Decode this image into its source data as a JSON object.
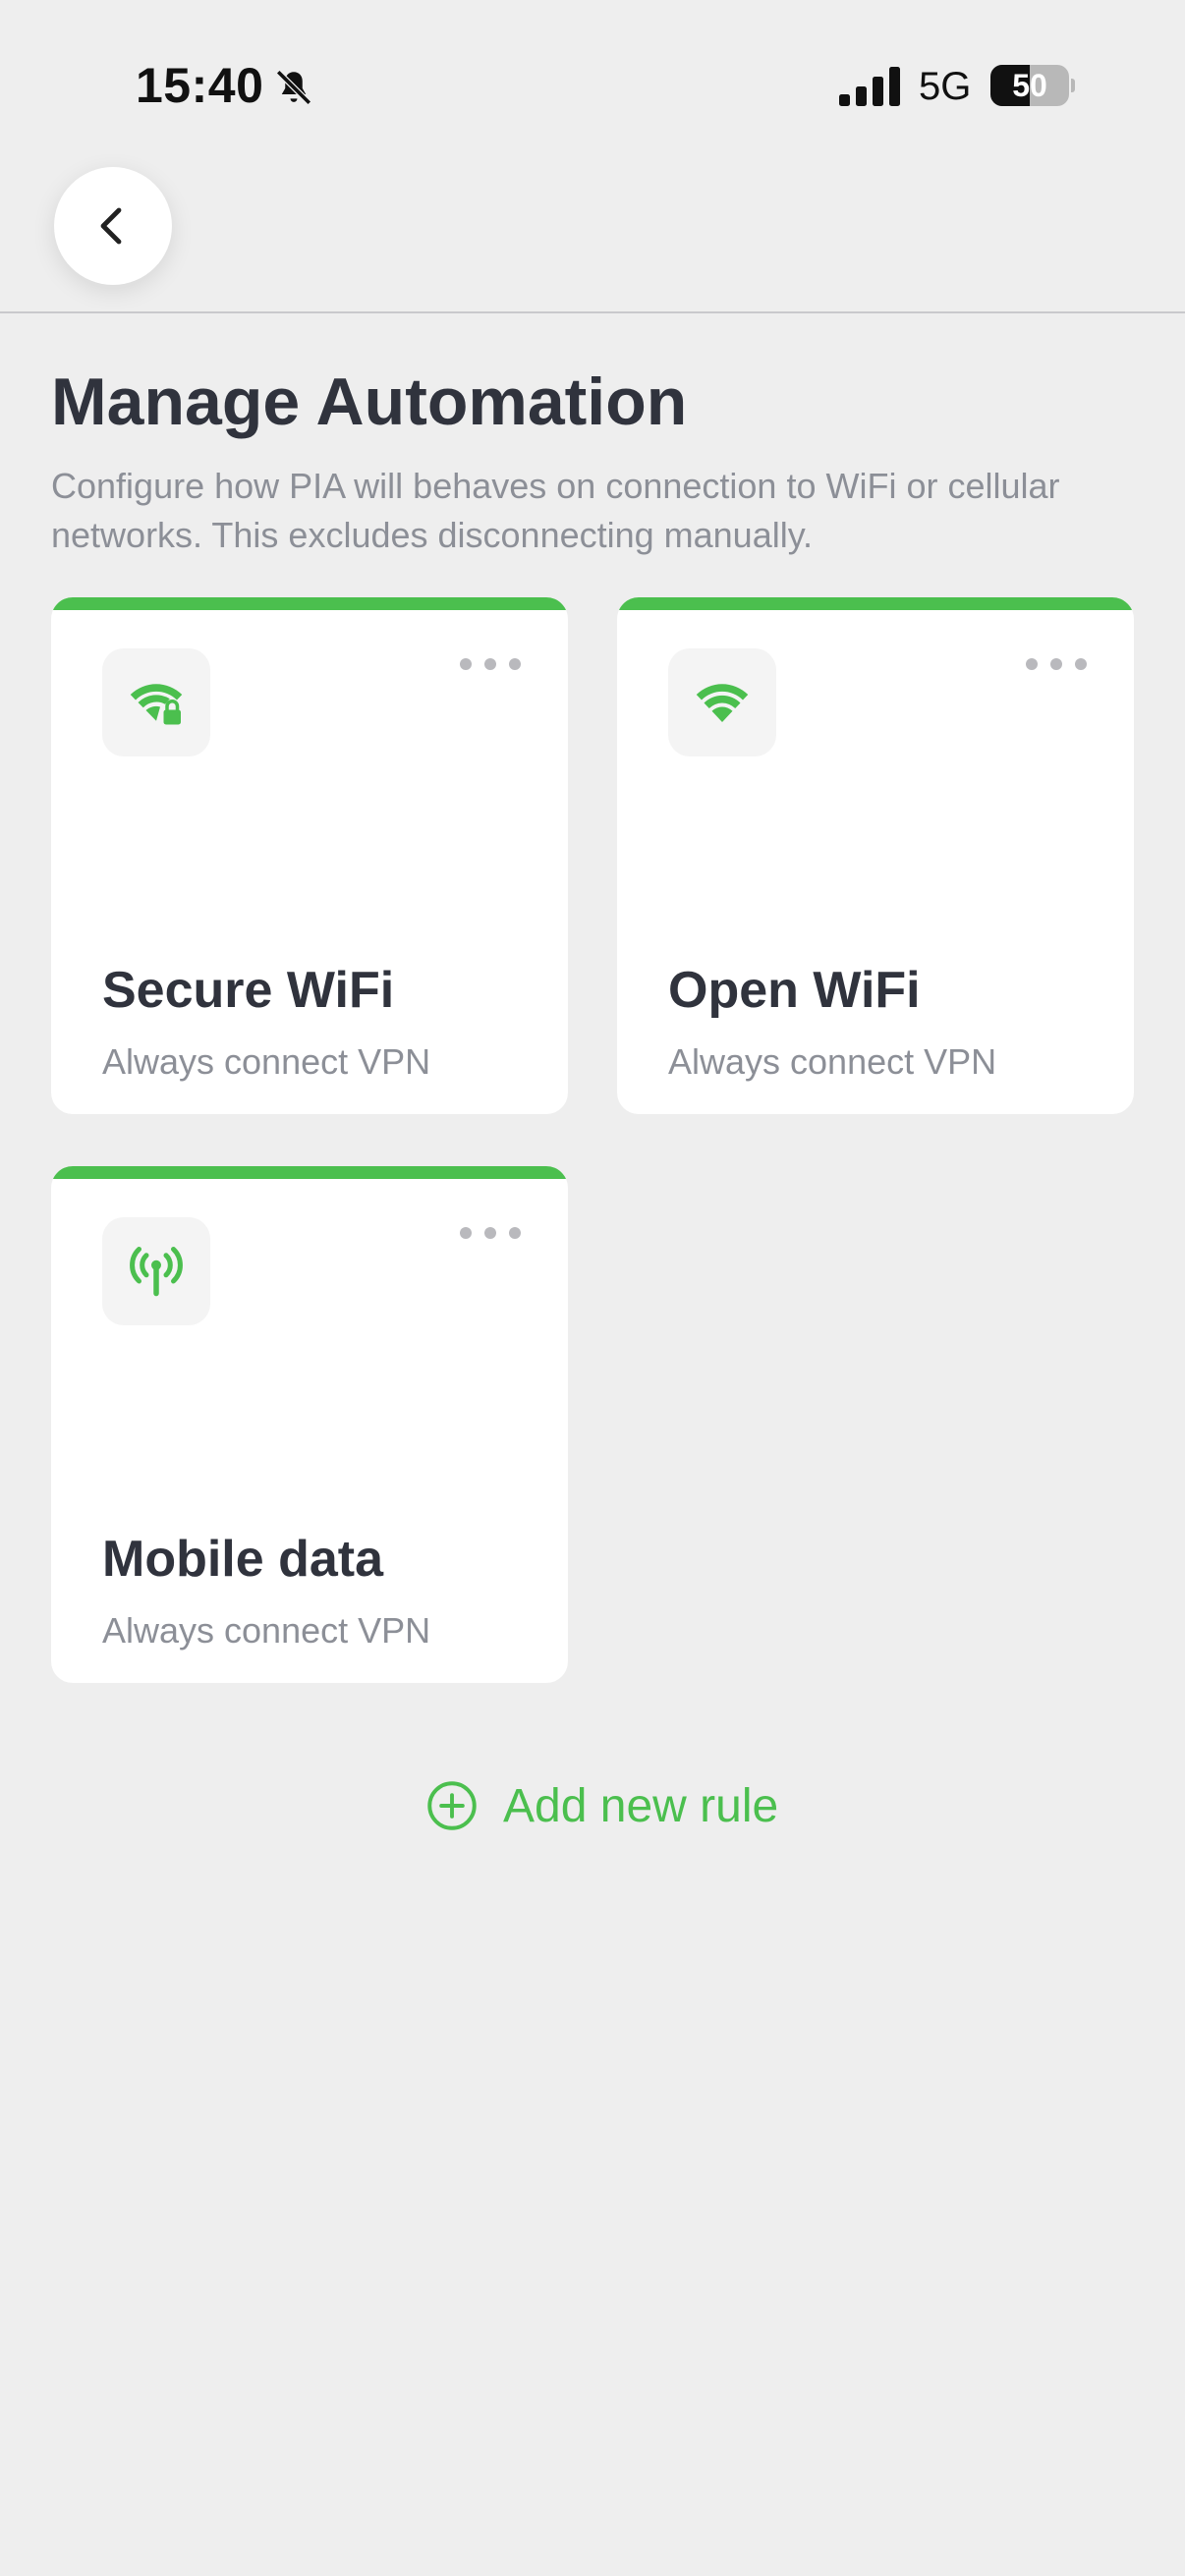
{
  "status_bar": {
    "time": "15:40",
    "network": "5G",
    "battery": "50",
    "battery_level": 0.5
  },
  "header": {
    "back_icon": "chevron-left-icon"
  },
  "page": {
    "title": "Manage Automation",
    "description": "Configure how PIA will behaves on connection to WiFi or cellular networks. This excludes disconnecting manually."
  },
  "rules": [
    {
      "title": "Secure WiFi",
      "action": "Always connect VPN",
      "icon": "secure-wifi-icon"
    },
    {
      "title": "Open WiFi",
      "action": "Always connect VPN",
      "icon": "wifi-icon"
    },
    {
      "title": "Mobile data",
      "action": "Always connect VPN",
      "icon": "cellular-antenna-icon"
    }
  ],
  "add_rule": {
    "label": "Add new rule",
    "icon": "plus-circle-icon"
  },
  "colors": {
    "accent": "#4bbf4e",
    "background": "#eeeeee",
    "card": "#ffffff",
    "title_text": "#30333d",
    "secondary_text": "#8c8f97"
  }
}
